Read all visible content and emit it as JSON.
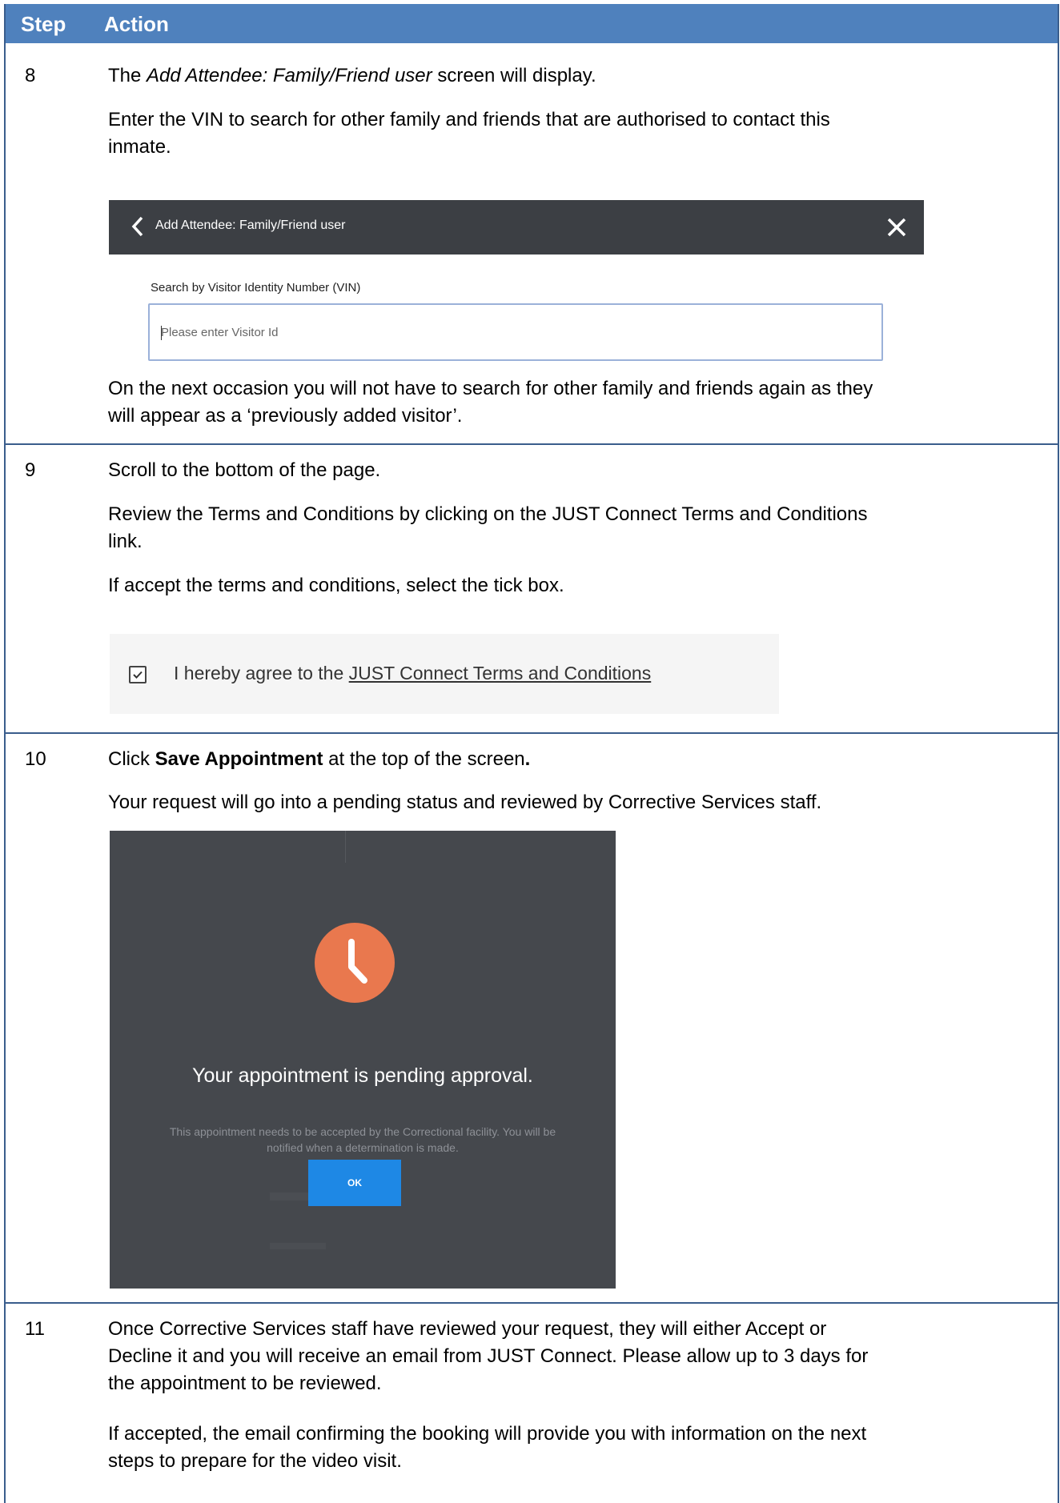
{
  "header": {
    "step": "Step",
    "action": "Action"
  },
  "steps": [
    {
      "number": "8",
      "p1_em": "Add Attendee: Family/Friend user",
      "p1_rest": " screen will display.",
      "p2_line1": "Enter the VIN to search for other family and friends that are authorised to contact this",
      "p2_line2": "inmate.",
      "p3_line1": "On the next occasion you will not have to search for other family and friends again as they",
      "p3_line2": "will appear as a ‘previously added visitor’."
    },
    {
      "number": "9",
      "p1": "Scroll to the bottom of the page.",
      "p2_line1": "Review the Terms and Conditions by clicking on the JUST Connect Terms and Conditions",
      "p2_line2": "link.",
      "p3": "If accept the terms and conditions, select the tick box."
    },
    {
      "number": "10",
      "p1_pre": "Click ",
      "p1_bold": "Save Appointment",
      "p1_post": " at the top of the screen",
      "p1_end": ".",
      "p2": "Your request will go into a pending status and reviewed by Corrective Services staff."
    },
    {
      "number": "11",
      "p1_line1": "Once Corrective Services staff have reviewed your request, they will either Accept or",
      "p1_line2": "Decline it and you will receive an email from JUST Connect. Please allow up to 3 days for",
      "p1_line3": "the appointment to be reviewed.",
      "p2_line1": "If accepted, the email confirming the booking will provide you with information on the next",
      "p2_line2": "steps to prepare for the video visit."
    }
  ],
  "attendee_screen": {
    "title": "Add Attendee: Family/Friend user",
    "search_label": "Search by Visitor Identity Number (VIN)",
    "search_placeholder": "Please enter Visitor Id"
  },
  "terms": {
    "prefix": "I hereby agree to the ",
    "link": "JUST Connect Terms and Conditions"
  },
  "pending_dialog": {
    "heading": "Your appointment is pending approval.",
    "message_line1": "This appointment needs to be accepted by the Correctional facility. You will be",
    "message_line2": "notified when a determination is made.",
    "ok_label": "OK",
    "icon_color": "#e9784e"
  }
}
